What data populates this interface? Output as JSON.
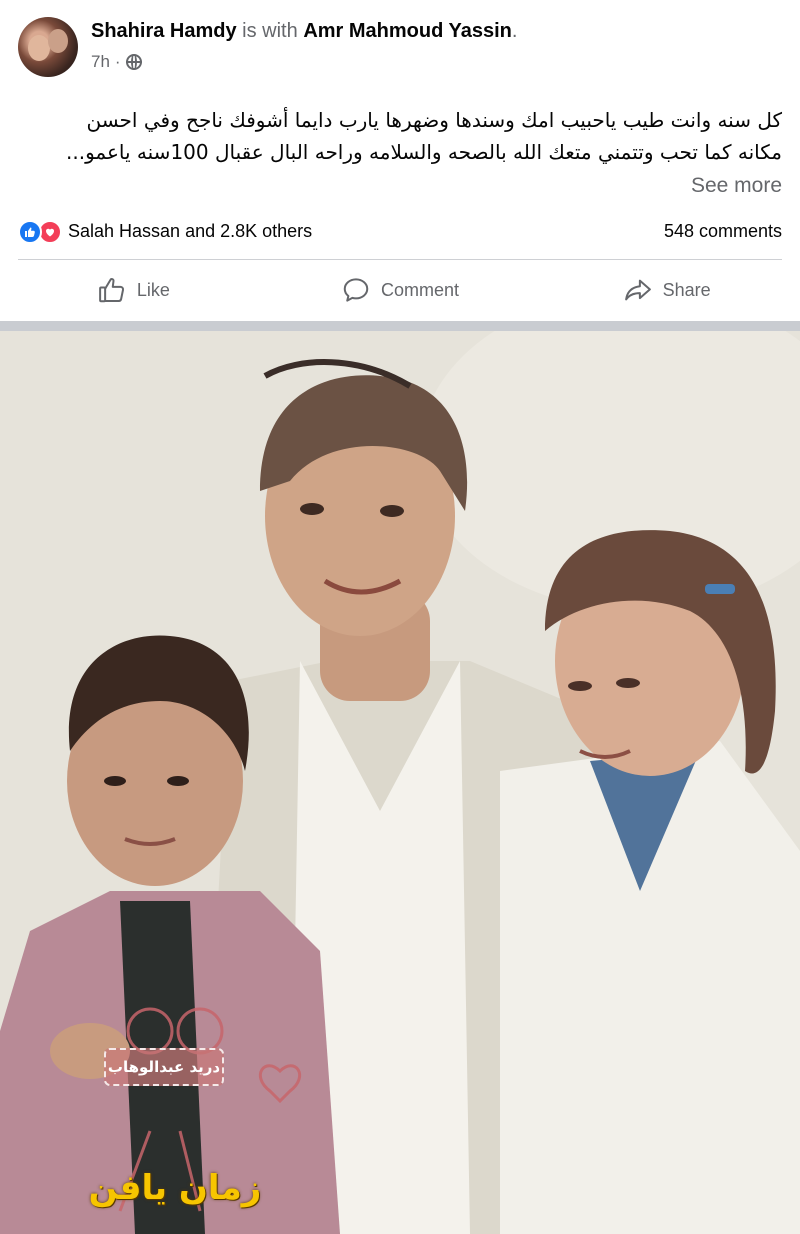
{
  "post": {
    "author": "Shahira Hamdy",
    "with_text": "is with",
    "tagged": "Amr Mahmoud Yassin",
    "tagged_suffix": ".",
    "time": "7h",
    "time_sep": "·",
    "privacy_icon": "globe-icon",
    "caption_lines": [
      "كل سنه وانت طيب ياحبيب امك وسندها وضهرها يارب دايما أشوفك  ناجح وفي احسن",
      "مكانه كما تحب وتتمني متعك الله بالصحه والسلامه وراحه البال عقبال 100سنه ياعمو..."
    ],
    "see_more": "See more"
  },
  "reactions": {
    "icons": [
      "like-icon",
      "love-icon"
    ],
    "text": "Salah Hassan and 2.8K others",
    "comments": "548 comments"
  },
  "actions": [
    {
      "label": "Like",
      "icon": "thumbs-up-icon"
    },
    {
      "label": "Comment",
      "icon": "comment-bubble-icon"
    },
    {
      "label": "Share",
      "icon": "share-arrow-icon"
    }
  ],
  "photo": {
    "watermark_box": "دريد عبدالوهاب",
    "watermark_title": "زمان يافن"
  },
  "colors": {
    "primary_text": "#050505",
    "secondary_text": "#65676b",
    "like_blue": "#1877f2",
    "love_red": "#f33e58",
    "watermark_yellow": "#f7c500"
  }
}
